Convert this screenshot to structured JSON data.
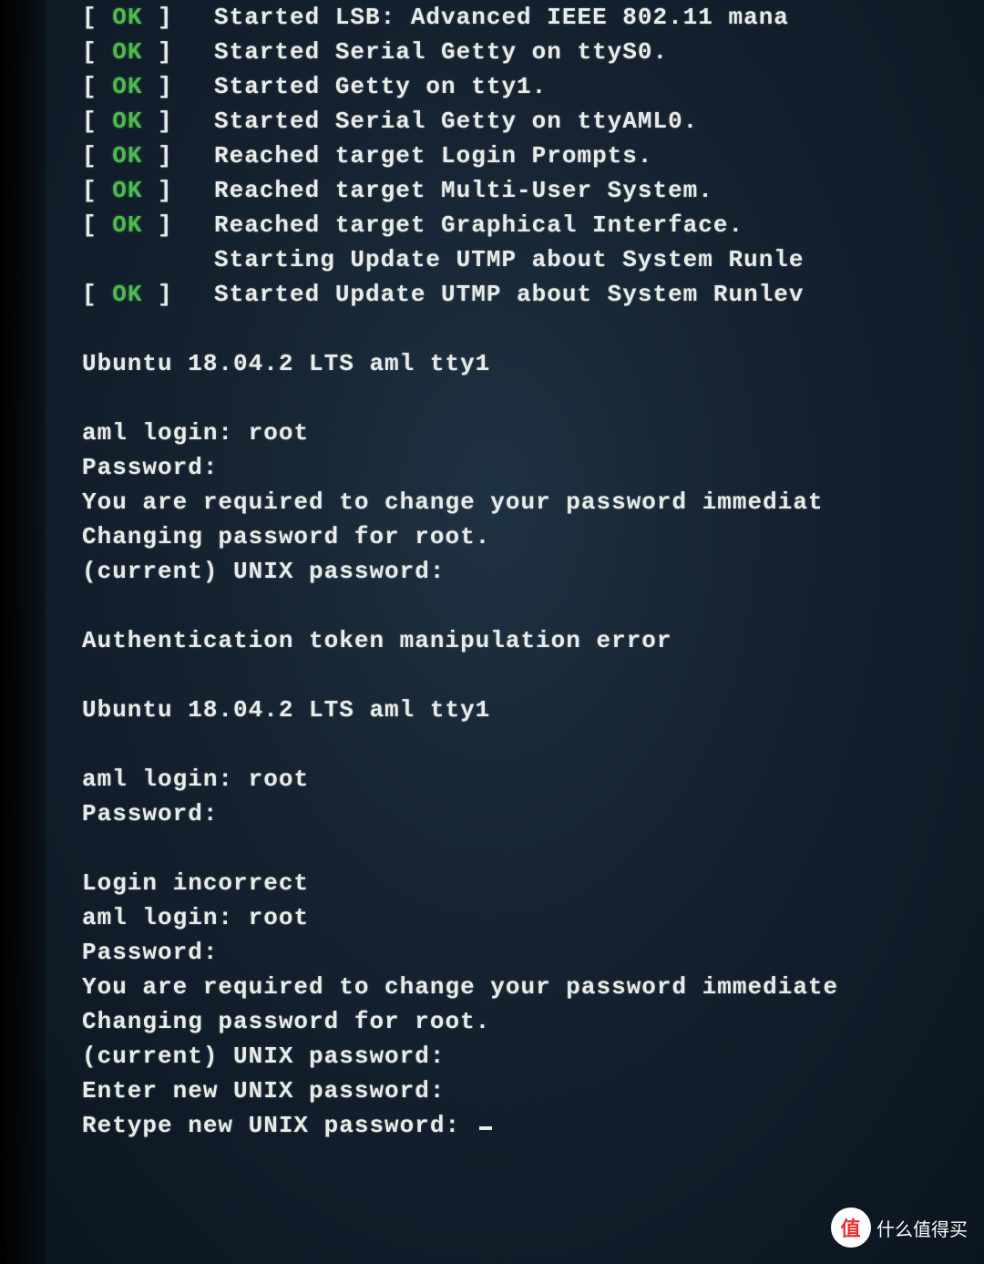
{
  "boot": {
    "lines": [
      {
        "status": "OK",
        "text": "Started LSB: Advanced IEEE 802.11 mana"
      },
      {
        "status": "OK",
        "text": "Started Serial Getty on ttyS0."
      },
      {
        "status": "OK",
        "text": "Started Getty on tty1."
      },
      {
        "status": "OK",
        "text": "Started Serial Getty on ttyAML0."
      },
      {
        "status": "OK",
        "text": "Reached target Login Prompts."
      },
      {
        "status": "OK",
        "text": "Reached target Multi-User System."
      },
      {
        "status": "OK",
        "text": "Reached target Graphical Interface."
      },
      {
        "status": "",
        "text": "Starting Update UTMP about System Runle"
      },
      {
        "status": "OK",
        "text": "Started Update UTMP about System Runlev"
      }
    ]
  },
  "banner1": "Ubuntu 18.04.2 LTS aml tty1",
  "login1": {
    "prompt": "aml login: ",
    "user": "root",
    "password_prompt": "Password:",
    "msg1": "You are required to change your password immediat",
    "msg2": "Changing password for root.",
    "msg3": "(current) UNIX password:"
  },
  "error1": "Authentication token manipulation error",
  "banner2": "Ubuntu 18.04.2 LTS aml tty1",
  "login2": {
    "prompt": "aml login: ",
    "user": "root",
    "password_prompt": "Password:"
  },
  "error2": "Login incorrect",
  "login3": {
    "prompt": "aml login: ",
    "user": "root",
    "password_prompt": "Password:",
    "msg1": "You are required to change your password immediate",
    "msg2": "Changing password for root.",
    "msg3": "(current) UNIX password:",
    "msg4": "Enter new UNIX password:",
    "msg5": "Retype new UNIX password: "
  },
  "watermark": {
    "icon": "值",
    "text": "什么值得买"
  }
}
